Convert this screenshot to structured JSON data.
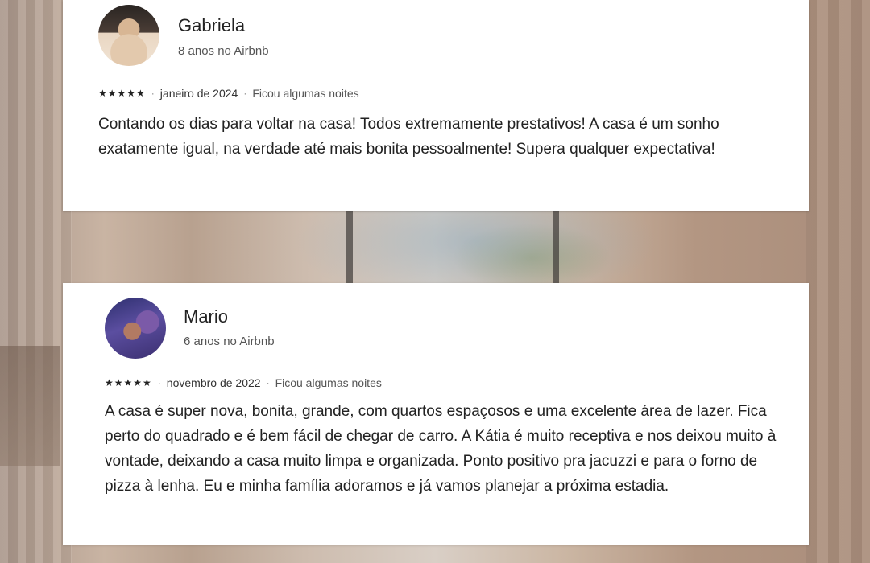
{
  "reviews": [
    {
      "name": "Gabriela",
      "tenure": "8 anos no Airbnb",
      "stars": "★★★★★",
      "date": "janeiro de 2024",
      "separator": "·",
      "stay_info": "Ficou algumas noites",
      "text": "Contando os dias para voltar na casa! Todos extremamente prestativos! A casa é um sonho exatamente igual, na verdade até mais bonita pessoalmente! Supera qualquer expectativa!",
      "avatar_icon": "user-photo-icon"
    },
    {
      "name": "Mario",
      "tenure": "6 anos no Airbnb",
      "stars": "★★★★★",
      "date": "novembro de 2022",
      "separator": "·",
      "stay_info": "Ficou algumas noites",
      "text": "A casa é super nova, bonita, grande, com quartos espaçosos e uma excelente área de lazer. Fica perto do quadrado e é bem fácil de chegar de carro. A Kátia é muito receptiva e nos deixou muito à vontade, deixando a casa muito limpa e organizada. Ponto positivo pra jacuzzi e para o forno de pizza à lenha. Eu e minha família adoramos e já vamos planejar a próxima estadia.",
      "avatar_icon": "user-photo-icon"
    }
  ]
}
